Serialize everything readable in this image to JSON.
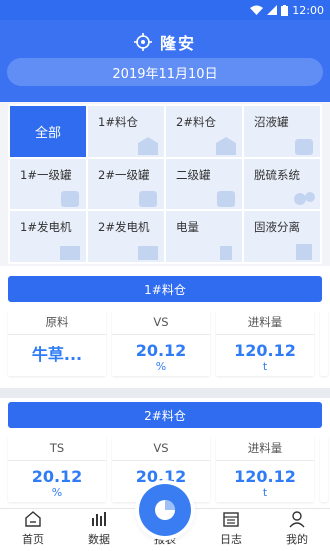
{
  "status_bar": {
    "time": "12:00"
  },
  "header": {
    "title": "隆安",
    "date": "2019年11月10日"
  },
  "grid": [
    {
      "label": "全部",
      "active": true
    },
    {
      "label": "1#料仓"
    },
    {
      "label": "2#料仓"
    },
    {
      "label": "沼液罐"
    },
    {
      "label": "1#一级罐"
    },
    {
      "label": "2#一级罐"
    },
    {
      "label": "二级罐"
    },
    {
      "label": "脱硫系统"
    },
    {
      "label": "1#发电机"
    },
    {
      "label": "2#发电机"
    },
    {
      "label": "电量"
    },
    {
      "label": "固液分离"
    }
  ],
  "sections": [
    {
      "title": "1#料仓",
      "cards": [
        {
          "label": "原料",
          "value": "牛草...",
          "unit": ""
        },
        {
          "label": "VS",
          "value": "20.12",
          "unit": "%"
        },
        {
          "label": "进料量",
          "value": "120.12",
          "unit": "t"
        }
      ]
    },
    {
      "title": "2#料仓",
      "cards": [
        {
          "label": "TS",
          "value": "20.12",
          "unit": "%"
        },
        {
          "label": "VS",
          "value": "20.12",
          "unit": "%"
        },
        {
          "label": "进料量",
          "value": "120.12",
          "unit": "t"
        }
      ]
    }
  ],
  "tabbar": [
    {
      "label": "首页",
      "icon": "home-icon"
    },
    {
      "label": "数据",
      "icon": "data-bars-icon"
    },
    {
      "label": "报表",
      "icon": "pie-chart-icon"
    },
    {
      "label": "日志",
      "icon": "calendar-icon"
    },
    {
      "label": "我的",
      "icon": "user-icon"
    }
  ],
  "colors": {
    "primary": "#2f6cf0",
    "accent": "#2f7cf6"
  }
}
